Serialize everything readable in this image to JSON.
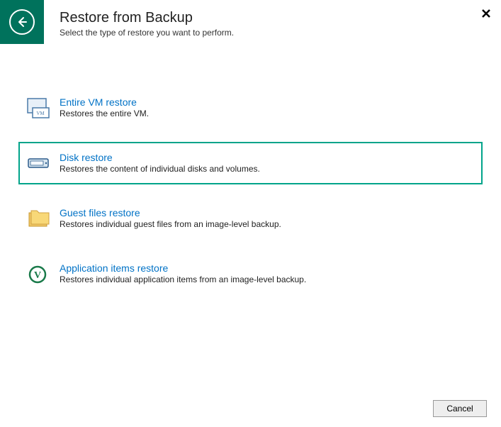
{
  "header": {
    "title": "Restore from Backup",
    "subtitle": "Select the type of restore you want to perform."
  },
  "options": [
    {
      "title": "Entire VM restore",
      "desc": "Restores the entire VM."
    },
    {
      "title": "Disk restore",
      "desc": "Restores the content of individual disks and volumes."
    },
    {
      "title": "Guest files restore",
      "desc": "Restores individual guest files from an image-level backup."
    },
    {
      "title": "Application items restore",
      "desc": "Restores individual application items from an image-level backup."
    }
  ],
  "footer": {
    "cancel": "Cancel"
  }
}
